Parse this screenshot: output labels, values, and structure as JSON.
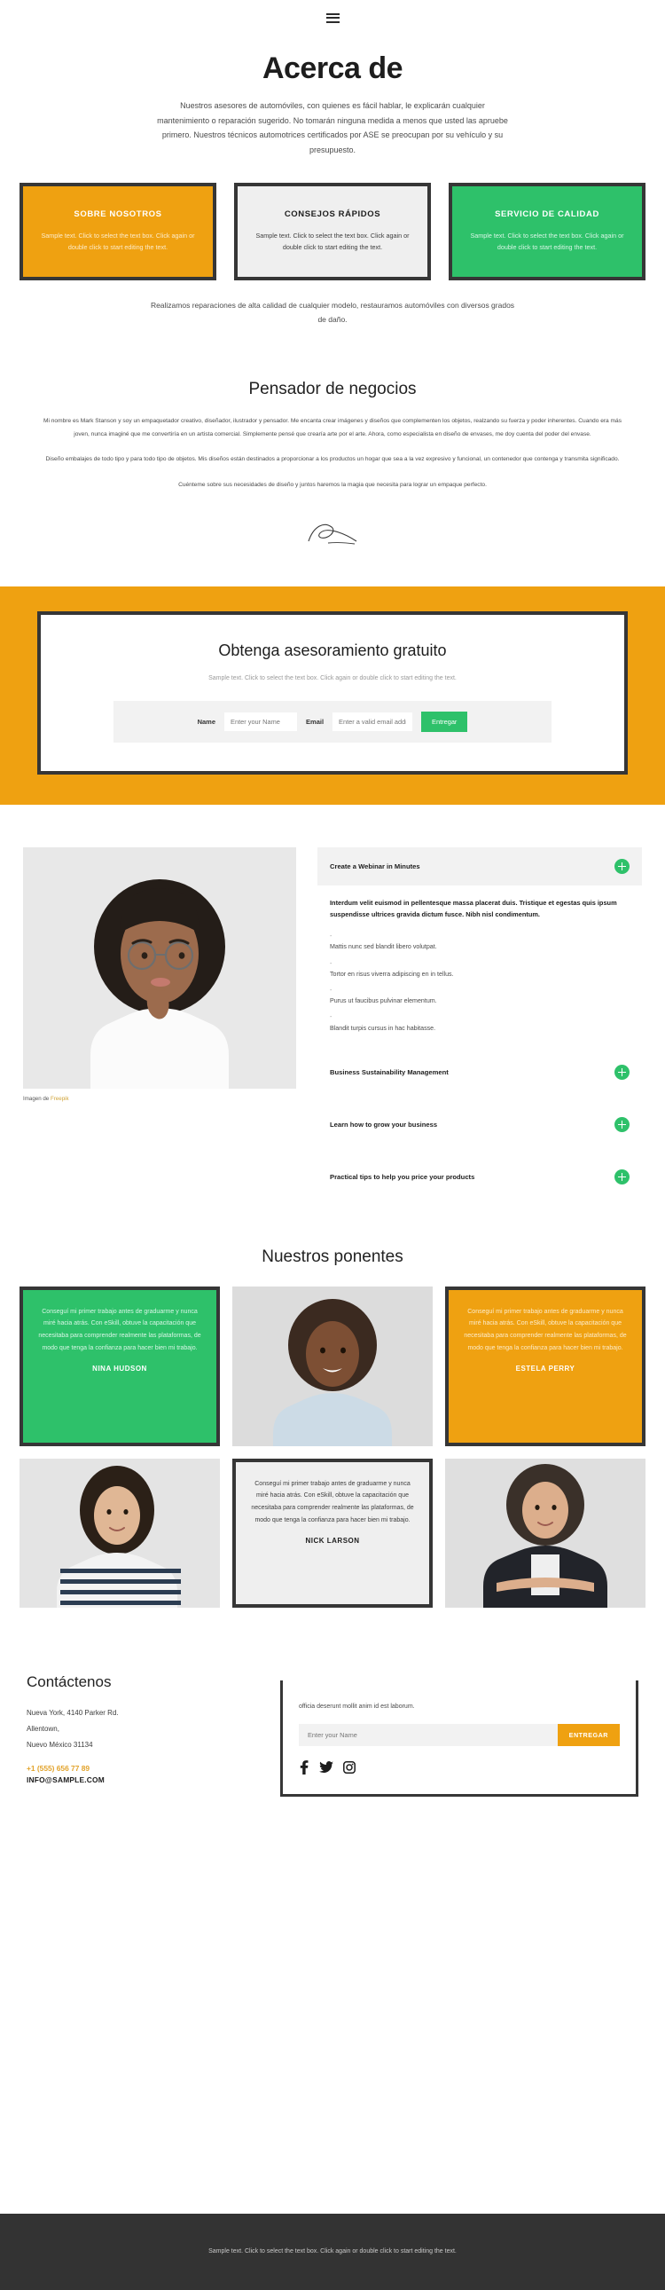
{
  "header": {
    "menu_icon": "hamburger-icon"
  },
  "hero": {
    "title": "Acerca de",
    "paragraph": "Nuestros asesores de automóviles, con quienes es fácil hablar, le explicarán cualquier mantenimiento o reparación sugerido. No tomarán ninguna medida a menos que usted las apruebe primero. Nuestros técnicos automotrices certificados por ASE se preocupan por su vehículo y su presupuesto."
  },
  "features": {
    "cards": [
      {
        "title": "SOBRE NOSOTROS",
        "body": "Sample text. Click to select the text box. Click again or double click to start editing the text.",
        "color": "#efa111"
      },
      {
        "title": "CONSEJOS RÁPIDOS",
        "body": "Sample text. Click to select the text box. Click again or double click to start editing the text.",
        "color": "#efefef"
      },
      {
        "title": "SERVICIO DE CALIDAD",
        "body": "Sample text. Click to select the text box. Click again or double click to start editing the text.",
        "color": "#2ec16a"
      }
    ],
    "caption": "Realizamos reparaciones de alta calidad de cualquier modelo, restauramos automóviles con diversos grados de daño."
  },
  "thinker": {
    "title": "Pensador de negocios",
    "p1": "Mi nombre es Mark Stanson y soy un empaquetador creativo, diseñador, ilustrador y pensador. Me encanta crear imágenes y diseños que complementen los objetos, realzando su fuerza y poder inherentes. Cuando era más joven, nunca imaginé que me convertiría en un artista comercial. Simplemente pensé que crearía arte por el arte. Ahora, como especialista en diseño de envases, me doy cuenta del poder del envase.",
    "p2": "Diseño embalajes de todo tipo y para todo tipo de objetos. Mis diseños están destinados a proporcionar a los productos un hogar que sea a la vez expresivo y funcional, un contenedor que contenga y transmita significado.",
    "p3": "Cuénteme sobre sus necesidades de diseño y juntos haremos la magia que necesita para lograr un empaque perfecto.",
    "signature_icon": "signature-scribble"
  },
  "cta": {
    "title": "Obtenga asesoramiento gratuito",
    "subtitle": "Sample text. Click to select the text box. Click again or double click to start editing the text.",
    "name_label": "Name",
    "name_placeholder": "Enter your Name",
    "email_label": "Email",
    "email_placeholder": "Enter a valid email addr",
    "submit_label": "Entregar",
    "accent": "#efa111",
    "button_color": "#2ec16a"
  },
  "accordion": {
    "image_credit_prefix": "Imagen de ",
    "image_credit_link": "Freepik",
    "items": [
      {
        "title": "Create a Webinar in Minutes",
        "expanded": true,
        "lead": "Interdum velit euismod in pellentesque massa placerat duis. Tristique et egestas quis ipsum suspendisse ultrices gravida dictum fusce. Nibh nisl condimentum.",
        "bullets": [
          "Mattis nunc sed blandit libero volutpat.",
          "Tortor en risus viverra adipiscing en in tellus.",
          "Purus ut faucibus pulvinar elementum.",
          "Blandit turpis cursus in hac habitasse."
        ]
      },
      {
        "title": "Business Sustainability Management",
        "expanded": false
      },
      {
        "title": "Learn how to grow your business",
        "expanded": false
      },
      {
        "title": "Practical tips to help you price your products",
        "expanded": false
      }
    ]
  },
  "speakers": {
    "title": "Nuestros ponentes",
    "quote_text": "Conseguí mi primer trabajo antes de graduarme y nunca miré hacia atrás. Con eSkill, obtuve la capacitación que necesitaba para comprender realmente las plataformas, de modo que tenga la confianza para hacer bien mi trabajo.",
    "people": [
      {
        "name": "NINA HUDSON",
        "color": "#2ec16a"
      },
      {
        "name": "ESTELA PERRY",
        "color": "#efa111"
      },
      {
        "name": "NICK LARSON",
        "color": "#efefef"
      }
    ]
  },
  "contact": {
    "title": "Contáctenos",
    "address_line1": "Nueva York, 4140 Parker Rd.",
    "address_line2": "Allentown,",
    "address_line3": "Nuevo México 31134",
    "phone": "+1 (555) 656 77 89",
    "email": "INFO@SAMPLE.COM",
    "lorem": "officia deserunt mollit anim id est laborum.",
    "name_placeholder": "Enter your Name",
    "submit_label": "ENTREGAR",
    "socials": [
      "facebook-icon",
      "twitter-icon",
      "instagram-icon"
    ]
  },
  "footer": {
    "text": "Sample text. Click to select the text box. Click again or double click to start editing the text."
  }
}
